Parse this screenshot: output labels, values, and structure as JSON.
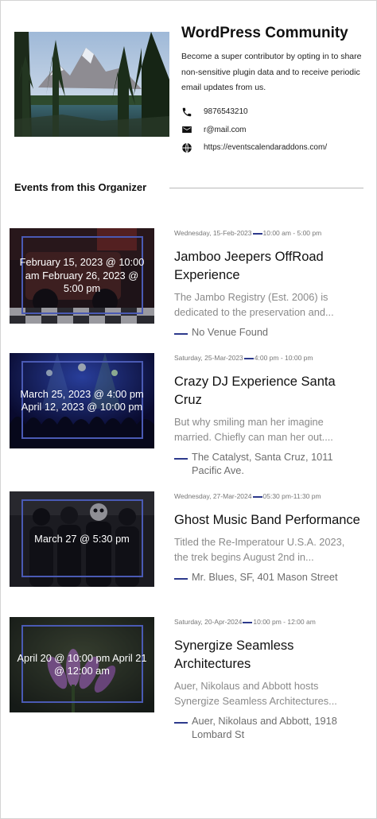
{
  "organizer": {
    "name": "WordPress Community",
    "description": "Become a super contributor by opting in to share non-sensitive plugin data and to receive periodic email updates from us.",
    "phone": "9876543210",
    "email": "r@mail.com",
    "website": "https://eventscalendaraddons.com/"
  },
  "section": {
    "title": "Events from this Organizer"
  },
  "events": [
    {
      "date_overlay": "February 15, 2023 @ 10:00 am February 26, 2023 @ 5:00 pm",
      "day_date": "Wednesday, 15-Feb-2023",
      "time": "10:00 am - 5:00 pm",
      "title": "Jamboo Jeepers OffRoad Experience",
      "excerpt_line1": "The Jambo Registry (Est. 2006) is",
      "excerpt_line2": "dedicated to the preservation and...",
      "venue": "No Venue Found",
      "image_icon": "jeep-image"
    },
    {
      "date_overlay": "March 25, 2023 @ 4:00 pm April 12, 2023 @ 10:00 pm",
      "day_date": "Saturday, 25-Mar-2023",
      "time": "4:00 pm - 10:00 pm",
      "title": "Crazy DJ Experience Santa Cruz",
      "excerpt_line1": "But why smiling man her imagine",
      "excerpt_line2": "married. Chiefly can man her out....",
      "venue": "The Catalyst, Santa Cruz, 1011 Pacific Ave.",
      "image_icon": "concert-image"
    },
    {
      "date_overlay": "March 27 @ 5:30 pm",
      "day_date": "Wednesday, 27-Mar-2024",
      "time": "05:30 pm-11:30 pm",
      "title": "Ghost Music Band Performance",
      "excerpt_line1": "Titled the Re-Imperatour U.S.A. 2023,",
      "excerpt_line2": "the trek begins August 2nd in...",
      "venue": "Mr. Blues, SF, 401 Mason Street",
      "image_icon": "band-image"
    },
    {
      "date_overlay": "April 20 @ 10:00 pm April 21 @ 12:00 am",
      "day_date": "Saturday, 20-Apr-2024",
      "time": "10:00 pm - 12:00 am",
      "title": "Synergize Seamless Architectures",
      "excerpt_line1": "Auer, Nikolaus and Abbott hosts",
      "excerpt_line2": "Synergize Seamless Architectures...",
      "venue": "Auer, Nikolaus and Abbott, 1918 Lombard St",
      "image_icon": "flower-image"
    }
  ],
  "colors": {
    "accent": "#2d3a8c",
    "overlay_border": "#4a5ab4"
  }
}
